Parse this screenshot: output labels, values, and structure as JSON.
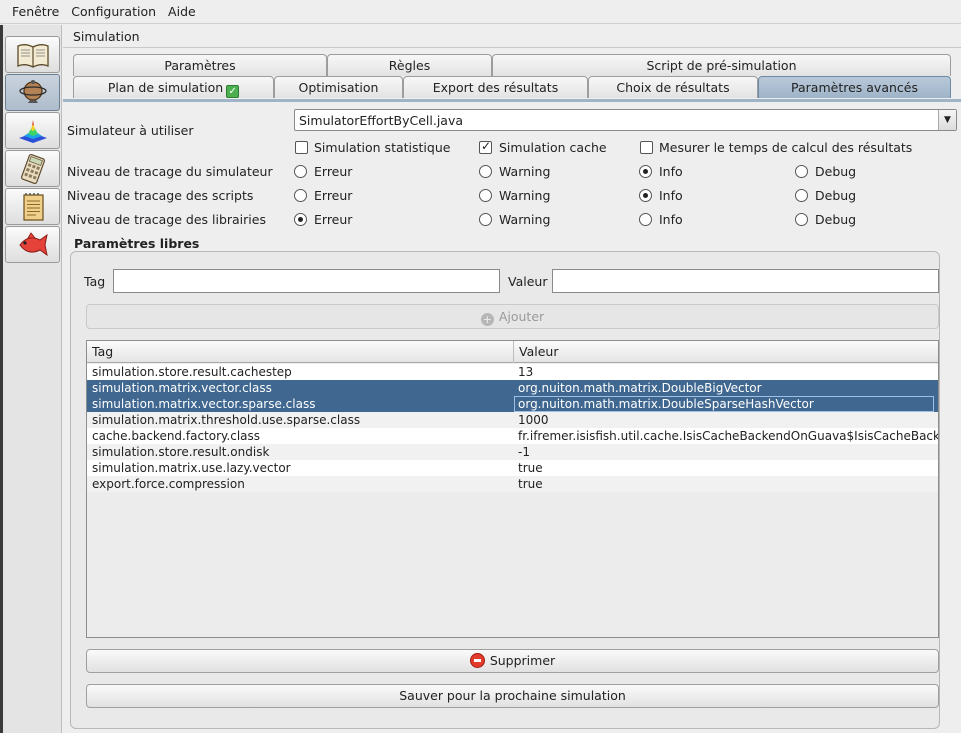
{
  "menubar": {
    "items": [
      "Fenêtre",
      "Configuration",
      "Aide"
    ]
  },
  "sidebar": {
    "icons": [
      "book-icon",
      "globe-icon",
      "surface-plot-icon",
      "calculator-icon",
      "notepad-icon",
      "fish-icon"
    ]
  },
  "window": {
    "title": "Simulation"
  },
  "tabs": {
    "row1": [
      "Paramètres",
      "Règles",
      "Script de pré-simulation"
    ],
    "row2": [
      "Plan de simulation",
      "Optimisation",
      "Export des résultats",
      "Choix de résultats",
      "Paramètres avancés"
    ],
    "active": "Paramètres avancés"
  },
  "form": {
    "simulator_label": "Simulateur à utiliser",
    "simulator_value": "SimulatorEffortByCell.java",
    "options": {
      "stat": "Simulation statistique",
      "cache": "Simulation cache",
      "timing": "Mesurer le temps de calcul des résultats"
    },
    "levels": [
      "Erreur",
      "Warning",
      "Info",
      "Debug"
    ],
    "rows": {
      "sim": "Niveau de tracage du simulateur",
      "scripts": "Niveau de tracage des scripts",
      "libs": "Niveau de tracage des librairies"
    },
    "selected": {
      "sim": "Info",
      "scripts": "Info",
      "libs": "Erreur"
    }
  },
  "free_params": {
    "title": "Paramètres libres",
    "tag_label": "Tag",
    "value_label": "Valeur",
    "tag_value": "",
    "value_value": "",
    "add_button": "Ajouter",
    "delete_button": "Supprimer",
    "save_button": "Sauver pour la prochaine simulation"
  },
  "table": {
    "headers": [
      "Tag",
      "Valeur"
    ],
    "rows": [
      {
        "tag": "simulation.store.result.cachestep",
        "value": "13"
      },
      {
        "tag": "simulation.matrix.vector.class",
        "value": "org.nuiton.math.matrix.DoubleBigVector"
      },
      {
        "tag": "simulation.matrix.vector.sparse.class",
        "value": "org.nuiton.math.matrix.DoubleSparseHashVector"
      },
      {
        "tag": "simulation.matrix.threshold.use.sparse.class",
        "value": "1000"
      },
      {
        "tag": "cache.backend.factory.class",
        "value": "fr.ifremer.isisfish.util.cache.IsisCacheBackendOnGuava$IsisCacheBacke..."
      },
      {
        "tag": "simulation.store.result.ondisk",
        "value": "-1"
      },
      {
        "tag": "simulation.matrix.use.lazy.vector",
        "value": "true"
      },
      {
        "tag": "export.force.compression",
        "value": "true"
      }
    ]
  },
  "colors": {
    "selection": "#3f6790",
    "active_tab": "#a9bdd1"
  }
}
